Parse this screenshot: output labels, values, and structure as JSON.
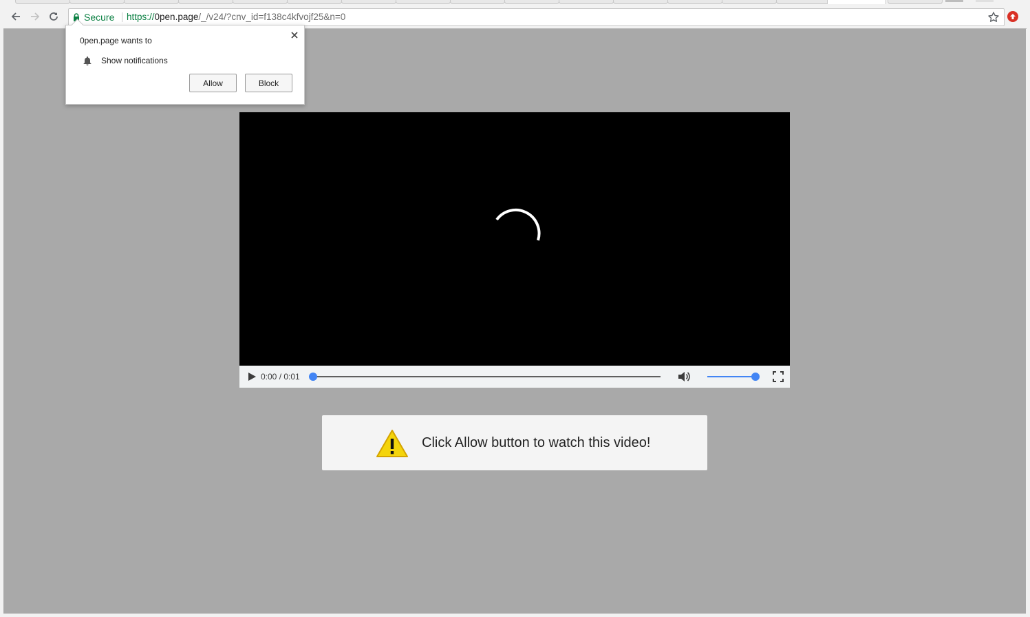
{
  "toolbar": {
    "secure_label": "Secure",
    "url_scheme": "https://",
    "url_host": "0pen.page",
    "url_path": "/_/v24/?cnv_id=f138c4kfvojf25&n=0"
  },
  "permission_popup": {
    "title": "0pen.page wants to",
    "permission_label": "Show notifications",
    "allow_label": "Allow",
    "block_label": "Block"
  },
  "video": {
    "time_display": "0:00 / 0:01",
    "progress_fraction": 0.0,
    "volume_fraction": 1.0
  },
  "banner": {
    "message": "Click Allow button to watch this video!"
  },
  "colors": {
    "page_background": "#a9a9a9",
    "secure_green": "#0b8043",
    "media_accent": "#4285f4",
    "warning_yellow": "#f4d40b"
  },
  "icons": {
    "back": "back-arrow-icon",
    "forward": "forward-arrow-icon",
    "reload": "reload-icon",
    "lock": "lock-icon",
    "bookmark": "star-icon",
    "extension": "extension-icon",
    "bell": "bell-icon",
    "close": "close-icon",
    "play": "play-icon",
    "volume": "volume-icon",
    "fullscreen": "fullscreen-icon",
    "warning": "warning-icon",
    "spinner": "loading-spinner"
  }
}
